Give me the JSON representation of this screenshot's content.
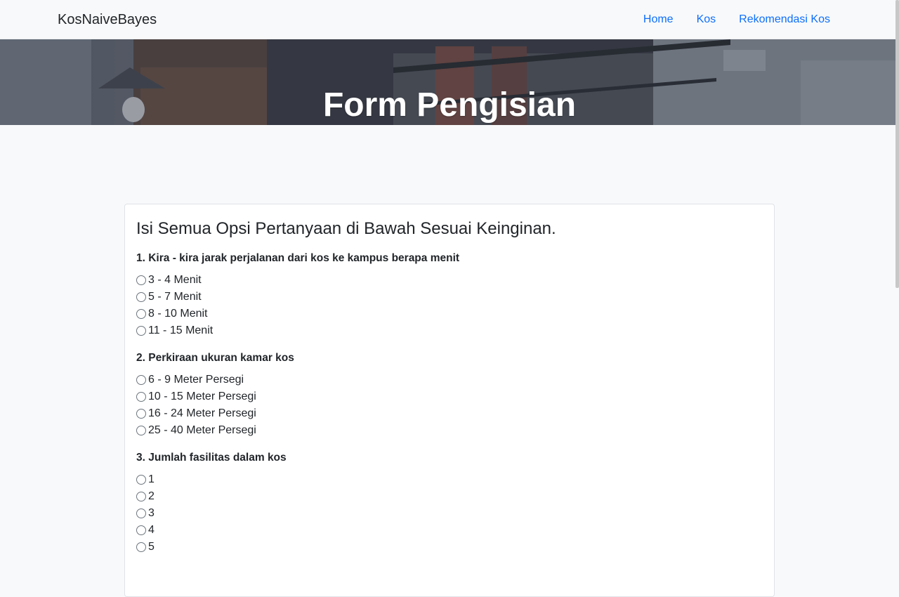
{
  "navbar": {
    "brand": "KosNaiveBayes",
    "links": [
      "Home",
      "Kos",
      "Rekomendasi Kos"
    ],
    "link_color": "#0d6efd"
  },
  "hero": {
    "title": "Form Pengisian"
  },
  "form": {
    "title": "Isi Semua Opsi Pertanyaan di Bawah Sesuai Keinginan.",
    "questions": [
      {
        "label": "1. Kira - kira jarak perjalanan dari kos ke kampus berapa menit",
        "options": [
          "3 - 4 Menit",
          "5 - 7 Menit",
          "8 - 10 Menit",
          "11 - 15 Menit"
        ]
      },
      {
        "label": "2. Perkiraan ukuran kamar kos",
        "options": [
          "6 - 9 Meter Persegi",
          "10 - 15 Meter Persegi",
          "16 - 24 Meter Persegi",
          "25 - 40 Meter Persegi"
        ]
      },
      {
        "label": "3. Jumlah fasilitas dalam kos",
        "options": [
          "1",
          "2",
          "3",
          "4",
          "5"
        ]
      }
    ]
  }
}
